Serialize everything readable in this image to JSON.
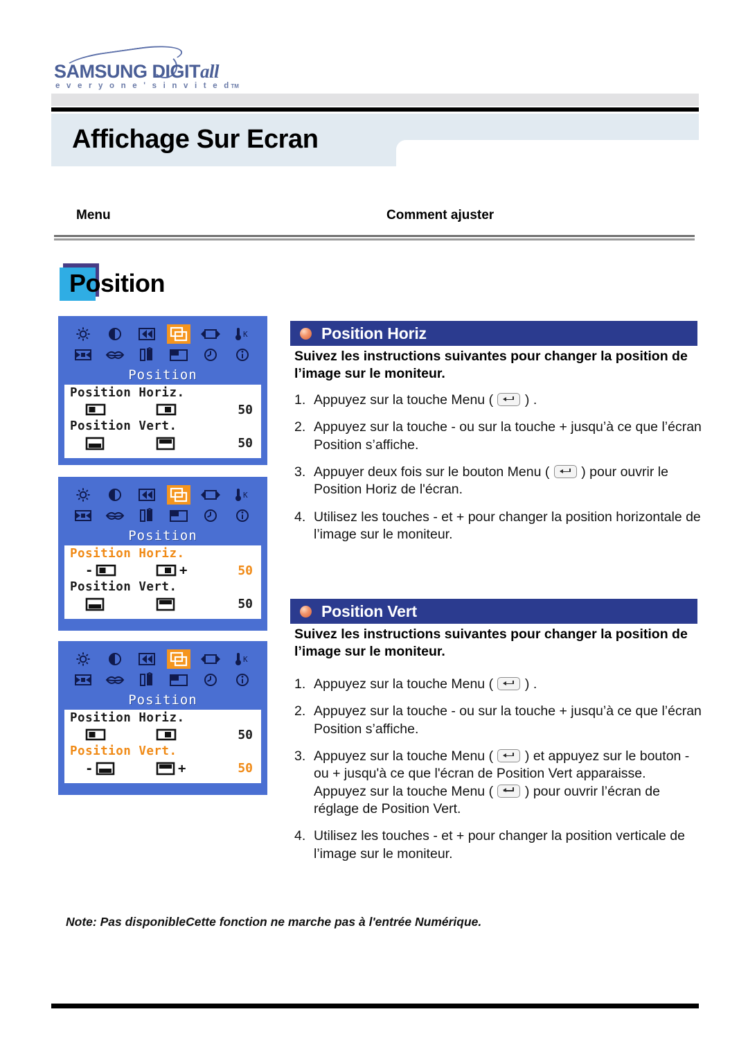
{
  "brand": {
    "logo_main": "SAMSUNG DIGIT",
    "logo_main_italic": "all",
    "logo_tagline": "e v e r y o n e ' s   i n v i t e d",
    "logo_tm": "TM"
  },
  "header": {
    "page_title": "Affichage Sur Ecran",
    "column_menu": "Menu",
    "column_adjust": "Comment ajuster"
  },
  "section": {
    "title": "Position",
    "square_back_color": "#473c86",
    "square_front_color": "#2fade4"
  },
  "osd": {
    "panel_bg": "#4a6fd2",
    "highlight_color": "#f5951e",
    "menu_title": "Position",
    "icons": [
      {
        "name": "brightness-icon",
        "label": "Brightness"
      },
      {
        "name": "contrast-icon",
        "label": "Contrast"
      },
      {
        "name": "image-lock-icon",
        "label": "Image Lock"
      },
      {
        "name": "position-icon",
        "label": "Position"
      },
      {
        "name": "size-icon",
        "label": "Size"
      },
      {
        "name": "color-temperature-icon",
        "label": "Color Temperature K"
      },
      {
        "name": "image-reset-icon",
        "label": "Image Reset"
      },
      {
        "name": "color-control-icon",
        "label": "Color Control"
      },
      {
        "name": "white-balance-icon",
        "label": "White Balance"
      },
      {
        "name": "osd-menu-position-icon",
        "label": "Menu Position"
      },
      {
        "name": "osd-display-time-icon",
        "label": "Display Time"
      },
      {
        "name": "information-icon",
        "label": "Information"
      }
    ],
    "selected_icon_index": 3,
    "panels": [
      {
        "id": "osd-panel-1",
        "rows": [
          {
            "label": "Position Horiz.",
            "value": "50",
            "highlighted": false,
            "show_pm": false
          },
          {
            "label": "Position Vert.",
            "value": "50",
            "highlighted": false,
            "show_pm": false
          }
        ]
      },
      {
        "id": "osd-panel-2",
        "rows": [
          {
            "label": "Position Horiz.",
            "value": "50",
            "highlighted": true,
            "show_pm": true
          },
          {
            "label": "Position Vert.",
            "value": "50",
            "highlighted": false,
            "show_pm": false
          }
        ]
      },
      {
        "id": "osd-panel-3",
        "rows": [
          {
            "label": "Position Horiz.",
            "value": "50",
            "highlighted": false,
            "show_pm": false
          },
          {
            "label": "Position Vert.",
            "value": "50",
            "highlighted": true,
            "show_pm": true
          }
        ]
      }
    ],
    "minus_sign": "-",
    "plus_sign": "+"
  },
  "sections": {
    "horiz": {
      "banner": "Position Horiz",
      "intro": "Suivez les instructions suivantes pour changer la position de l’image sur le moniteur.",
      "steps": [
        {
          "num": "1.",
          "pre": "Appuyez sur la touche Menu ( ",
          "post": " ) ."
        },
        {
          "num": "2.",
          "pre": "Appuyez sur la touche - ou sur la touche + jusqu’à ce que l’écran Position s’affiche.",
          "post": ""
        },
        {
          "num": "3.",
          "pre": "Appuyer deux fois sur le bouton Menu ( ",
          "post": " ) pour ouvrir le Position Horiz de l'écran."
        },
        {
          "num": "4.",
          "pre": "Utilisez les touches - et + pour changer la position horizontale de l’image sur le moniteur.",
          "post": ""
        }
      ]
    },
    "vert": {
      "banner": "Position Vert",
      "intro": "Suivez les instructions suivantes pour changer la position de l’image sur le moniteur.",
      "steps": [
        {
          "num": "1.",
          "pre": "Appuyez sur la touche Menu ( ",
          "post": " ) ."
        },
        {
          "num": "2.",
          "pre": "Appuyez sur la touche - ou sur la touche + jusqu’à ce que l’écran Position s’affiche.",
          "post": ""
        },
        {
          "num": "3.",
          "pre": "Appuyez sur la touche Menu ( ",
          "post": " ) et appuyez sur le bouton - ou + jusqu'à ce que l'écran de Position Vert apparaisse.",
          "pre2": "Appuyez sur la touche Menu ( ",
          "post2": " ) pour ouvrir l’écran de réglage de Position Vert."
        },
        {
          "num": "4.",
          "pre": "Utilisez les touches - et + pour changer la position verticale de l’image sur le moniteur.",
          "post": ""
        }
      ]
    }
  },
  "note": "Note: Pas disponibleCette fonction ne marche pas à l'entrée Numérique."
}
